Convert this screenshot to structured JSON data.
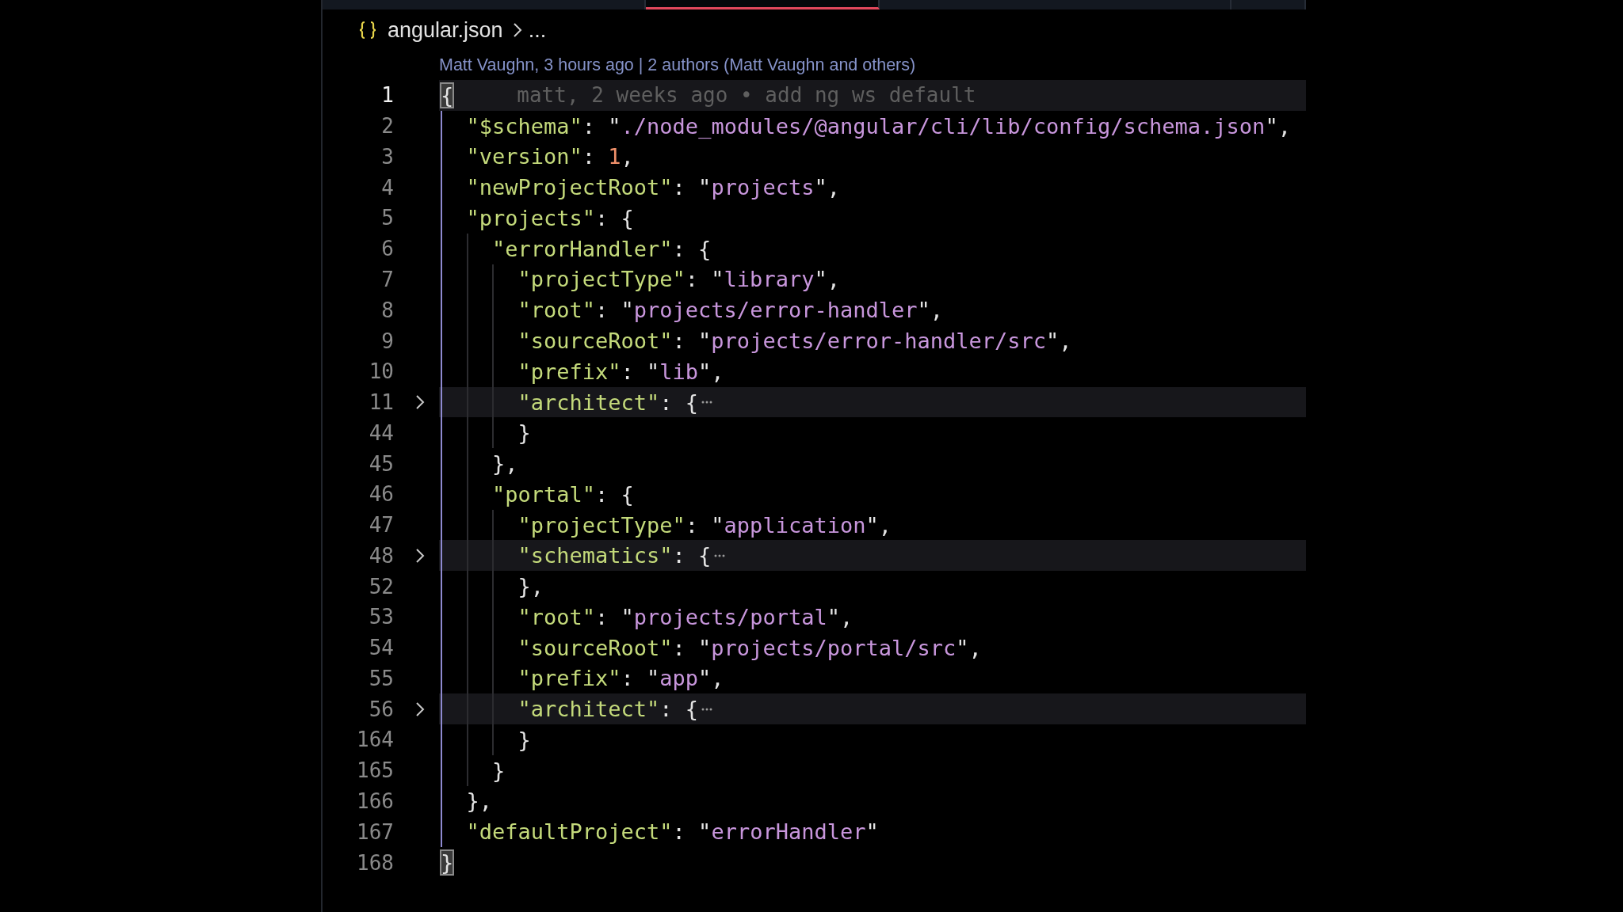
{
  "tabs": [
    {
      "selected": false
    },
    {
      "selected": true
    },
    {
      "selected": false
    },
    {
      "selected": false
    }
  ],
  "breadcrumb": {
    "file": "angular.json",
    "rest": "..."
  },
  "codelens": "Matt Vaughn, 3 hours ago | 2 authors (Matt Vaughn and others)",
  "lines": [
    {
      "number": "1",
      "active": true,
      "folded": false,
      "bracket_match": true,
      "blame": "matt, 2 weeks ago • add ng ws default",
      "tokens": [
        {
          "kind": "punct",
          "text": "{"
        }
      ]
    },
    {
      "number": "2",
      "active": false,
      "folded": false,
      "bracket_match": false,
      "tokens": [
        {
          "kind": "key",
          "text": "  \"$schema\""
        },
        {
          "kind": "punct",
          "text": ": \""
        },
        {
          "kind": "string",
          "text": "./node_modules/@angular/cli/lib/config/schema.json"
        },
        {
          "kind": "punct",
          "text": "\","
        }
      ]
    },
    {
      "number": "3",
      "active": false,
      "folded": false,
      "bracket_match": false,
      "tokens": [
        {
          "kind": "key",
          "text": "  \"version\""
        },
        {
          "kind": "punct",
          "text": ": "
        },
        {
          "kind": "number",
          "text": "1"
        },
        {
          "kind": "punct",
          "text": ","
        }
      ]
    },
    {
      "number": "4",
      "active": false,
      "folded": false,
      "bracket_match": false,
      "tokens": [
        {
          "kind": "key",
          "text": "  \"newProjectRoot\""
        },
        {
          "kind": "punct",
          "text": ": \""
        },
        {
          "kind": "string",
          "text": "projects"
        },
        {
          "kind": "punct",
          "text": "\","
        }
      ]
    },
    {
      "number": "5",
      "active": false,
      "folded": false,
      "bracket_match": false,
      "tokens": [
        {
          "kind": "key",
          "text": "  \"projects\""
        },
        {
          "kind": "punct",
          "text": ": {"
        }
      ]
    },
    {
      "number": "6",
      "active": false,
      "folded": false,
      "bracket_match": false,
      "tokens": [
        {
          "kind": "key",
          "text": "    \"errorHandler\""
        },
        {
          "kind": "punct",
          "text": ": {"
        }
      ]
    },
    {
      "number": "7",
      "active": false,
      "folded": false,
      "bracket_match": false,
      "tokens": [
        {
          "kind": "key",
          "text": "      \"projectType\""
        },
        {
          "kind": "punct",
          "text": ": \""
        },
        {
          "kind": "string",
          "text": "library"
        },
        {
          "kind": "punct",
          "text": "\","
        }
      ]
    },
    {
      "number": "8",
      "active": false,
      "folded": false,
      "bracket_match": false,
      "tokens": [
        {
          "kind": "key",
          "text": "      \"root\""
        },
        {
          "kind": "punct",
          "text": ": \""
        },
        {
          "kind": "string",
          "text": "projects/error-handler"
        },
        {
          "kind": "punct",
          "text": "\","
        }
      ]
    },
    {
      "number": "9",
      "active": false,
      "folded": false,
      "bracket_match": false,
      "tokens": [
        {
          "kind": "key",
          "text": "      \"sourceRoot\""
        },
        {
          "kind": "punct",
          "text": ": \""
        },
        {
          "kind": "string",
          "text": "projects/error-handler/src"
        },
        {
          "kind": "punct",
          "text": "\","
        }
      ]
    },
    {
      "number": "10",
      "active": false,
      "folded": false,
      "bracket_match": false,
      "tokens": [
        {
          "kind": "key",
          "text": "      \"prefix\""
        },
        {
          "kind": "punct",
          "text": ": \""
        },
        {
          "kind": "string",
          "text": "lib"
        },
        {
          "kind": "punct",
          "text": "\","
        }
      ]
    },
    {
      "number": "11",
      "active": false,
      "folded": true,
      "bracket_match": false,
      "tokens": [
        {
          "kind": "key",
          "text": "      \"architect\""
        },
        {
          "kind": "punct",
          "text": ": {"
        }
      ]
    },
    {
      "number": "44",
      "active": false,
      "folded": false,
      "bracket_match": false,
      "tokens": [
        {
          "kind": "punct",
          "text": "      }"
        }
      ]
    },
    {
      "number": "45",
      "active": false,
      "folded": false,
      "bracket_match": false,
      "tokens": [
        {
          "kind": "punct",
          "text": "    },"
        }
      ]
    },
    {
      "number": "46",
      "active": false,
      "folded": false,
      "bracket_match": false,
      "tokens": [
        {
          "kind": "key",
          "text": "    \"portal\""
        },
        {
          "kind": "punct",
          "text": ": {"
        }
      ]
    },
    {
      "number": "47",
      "active": false,
      "folded": false,
      "bracket_match": false,
      "tokens": [
        {
          "kind": "key",
          "text": "      \"projectType\""
        },
        {
          "kind": "punct",
          "text": ": \""
        },
        {
          "kind": "string",
          "text": "application"
        },
        {
          "kind": "punct",
          "text": "\","
        }
      ]
    },
    {
      "number": "48",
      "active": false,
      "folded": true,
      "bracket_match": false,
      "tokens": [
        {
          "kind": "key",
          "text": "      \"schematics\""
        },
        {
          "kind": "punct",
          "text": ": {"
        }
      ]
    },
    {
      "number": "52",
      "active": false,
      "folded": false,
      "bracket_match": false,
      "tokens": [
        {
          "kind": "punct",
          "text": "      },"
        }
      ]
    },
    {
      "number": "53",
      "active": false,
      "folded": false,
      "bracket_match": false,
      "tokens": [
        {
          "kind": "key",
          "text": "      \"root\""
        },
        {
          "kind": "punct",
          "text": ": \""
        },
        {
          "kind": "string",
          "text": "projects/portal"
        },
        {
          "kind": "punct",
          "text": "\","
        }
      ]
    },
    {
      "number": "54",
      "active": false,
      "folded": false,
      "bracket_match": false,
      "tokens": [
        {
          "kind": "key",
          "text": "      \"sourceRoot\""
        },
        {
          "kind": "punct",
          "text": ": \""
        },
        {
          "kind": "string",
          "text": "projects/portal/src"
        },
        {
          "kind": "punct",
          "text": "\","
        }
      ]
    },
    {
      "number": "55",
      "active": false,
      "folded": false,
      "bracket_match": false,
      "tokens": [
        {
          "kind": "key",
          "text": "      \"prefix\""
        },
        {
          "kind": "punct",
          "text": ": \""
        },
        {
          "kind": "string",
          "text": "app"
        },
        {
          "kind": "punct",
          "text": "\","
        }
      ]
    },
    {
      "number": "56",
      "active": false,
      "folded": true,
      "bracket_match": false,
      "tokens": [
        {
          "kind": "key",
          "text": "      \"architect\""
        },
        {
          "kind": "punct",
          "text": ": {"
        }
      ]
    },
    {
      "number": "164",
      "active": false,
      "folded": false,
      "bracket_match": false,
      "tokens": [
        {
          "kind": "punct",
          "text": "      }"
        }
      ]
    },
    {
      "number": "165",
      "active": false,
      "folded": false,
      "bracket_match": false,
      "tokens": [
        {
          "kind": "punct",
          "text": "    }"
        }
      ]
    },
    {
      "number": "166",
      "active": false,
      "folded": false,
      "bracket_match": false,
      "tokens": [
        {
          "kind": "punct",
          "text": "  },"
        }
      ]
    },
    {
      "number": "167",
      "active": false,
      "folded": false,
      "bracket_match": false,
      "tokens": [
        {
          "kind": "key",
          "text": "  \"defaultProject\""
        },
        {
          "kind": "punct",
          "text": ": \""
        },
        {
          "kind": "string",
          "text": "errorHandler"
        },
        {
          "kind": "punct",
          "text": "\""
        }
      ]
    },
    {
      "number": "168",
      "active": false,
      "folded": false,
      "bracket_match": true,
      "tokens": [
        {
          "kind": "punct",
          "text": "}"
        }
      ]
    }
  ]
}
